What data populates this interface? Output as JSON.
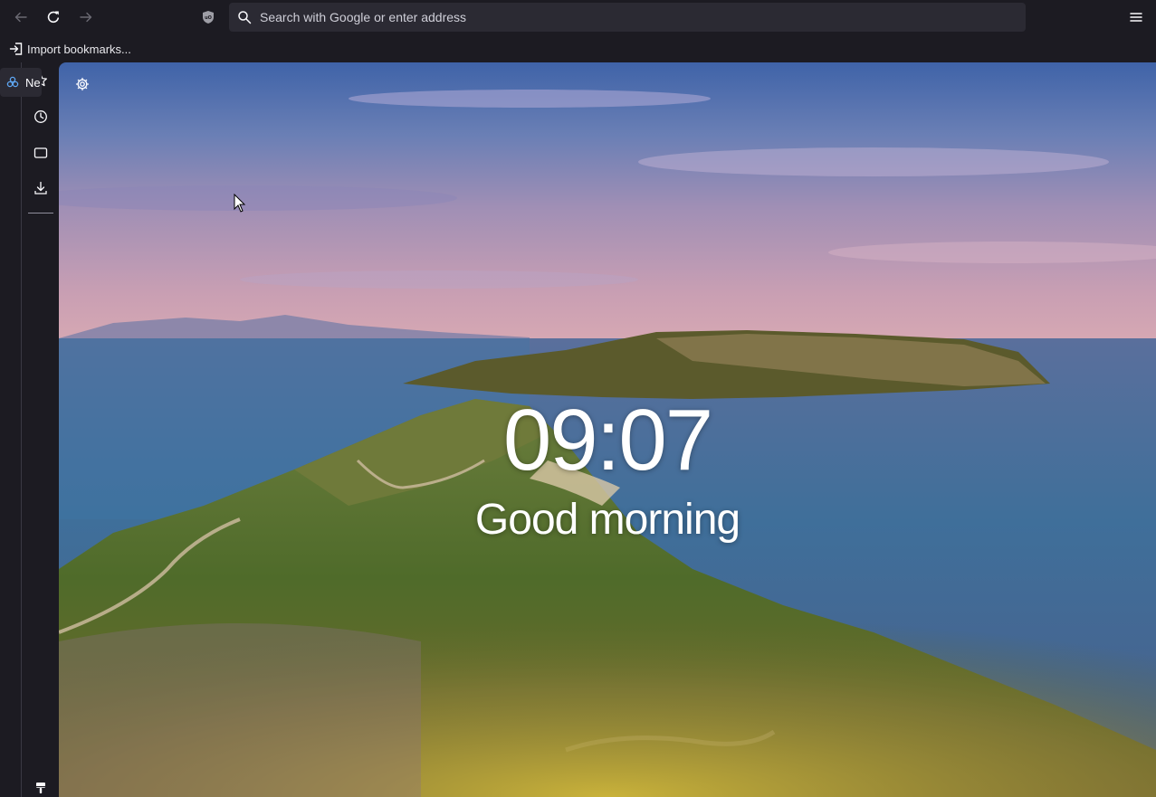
{
  "toolbar": {
    "back_icon": "arrow-left-icon",
    "reload_icon": "reload-icon",
    "forward_icon": "arrow-right-icon",
    "extension_icon": "ublock-origin-icon",
    "url_placeholder": "Search with Google or enter address",
    "url_value": "",
    "menu_icon": "hamburger-menu-icon"
  },
  "bookmarks_bar": {
    "import_label": "Import bookmarks..."
  },
  "tabs": [
    {
      "label": "New Tab",
      "visible_label": "Ne",
      "icon": "firefox-newtab-icon",
      "active": true
    }
  ],
  "sidebar": {
    "items": [
      {
        "name": "bookmarks",
        "icon": "star-icon"
      },
      {
        "name": "history",
        "icon": "clock-icon"
      },
      {
        "name": "synced-tabs",
        "icon": "tabs-icon"
      },
      {
        "name": "downloads",
        "icon": "download-icon"
      }
    ],
    "customize_icon": "paintbrush-icon"
  },
  "newtab": {
    "settings_icon": "gear-icon",
    "clock": "09:07",
    "greeting": "Good morning",
    "background": "coastal-landscape-photo"
  },
  "colors": {
    "chrome_bg": "#1c1b22",
    "urlbar_bg": "#2b2a33",
    "text": "#fbfbfe"
  }
}
